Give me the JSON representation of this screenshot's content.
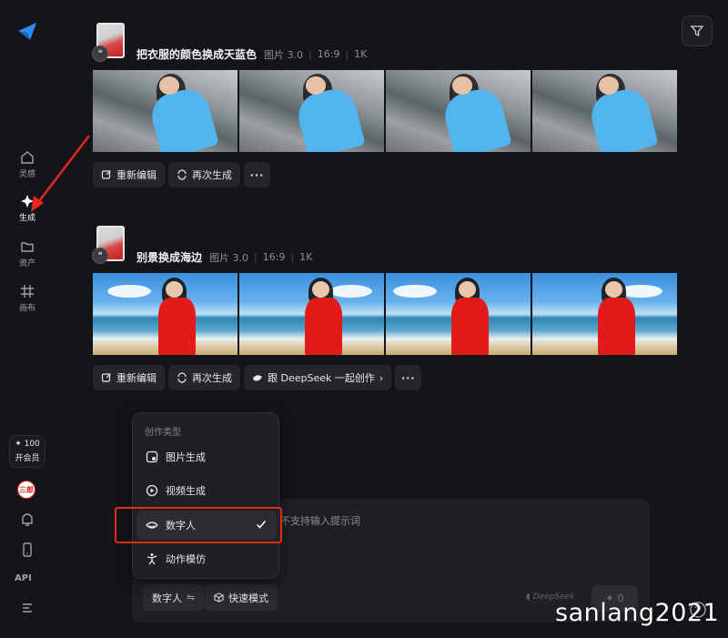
{
  "sidebar": {
    "items": [
      {
        "label": "灵感",
        "icon": "home-icon"
      },
      {
        "label": "生成",
        "icon": "sparkle-icon",
        "active": true
      },
      {
        "label": "资产",
        "icon": "folder-icon"
      },
      {
        "label": "画布",
        "icon": "canvas-icon"
      }
    ],
    "vip": {
      "points": "✦ 100",
      "label": "开会员"
    },
    "avatar_text": "三郎",
    "api_label": "API"
  },
  "generations": [
    {
      "prompt": "把衣服的颜色换成天蓝色",
      "type": "图片 3.0",
      "ratio": "16:9",
      "resolution": "1K",
      "actions": [
        "重新编辑",
        "再次生成"
      ],
      "more": "···"
    },
    {
      "prompt": "别景换成海边",
      "type": "图片 3.0",
      "ratio": "16:9",
      "resolution": "1K",
      "actions": [
        "重新编辑",
        "再次生成",
        "跟 DeepSeek 一起创作"
      ],
      "more": "···"
    }
  ],
  "menu": {
    "header": "创作类型",
    "items": [
      {
        "label": "图片生成",
        "icon": "image-gen-icon"
      },
      {
        "label": "视频生成",
        "icon": "video-gen-icon"
      },
      {
        "label": "数字人",
        "icon": "digital-human-icon",
        "selected": true
      },
      {
        "label": "动作模仿",
        "icon": "motion-mimic-icon"
      }
    ]
  },
  "input": {
    "placeholder": "不支持输入提示词",
    "mode_label": "数字人",
    "mode_switch": "⇋",
    "speed_label": "快速模式",
    "deepseek_tag": "DeepSeek",
    "send_count": "0"
  },
  "watermark": "sanlang2021",
  "colors": {
    "background": "#141518",
    "panel": "#1f2024",
    "highlight": "#e5271d",
    "accent_blue": "#2f8df5"
  }
}
